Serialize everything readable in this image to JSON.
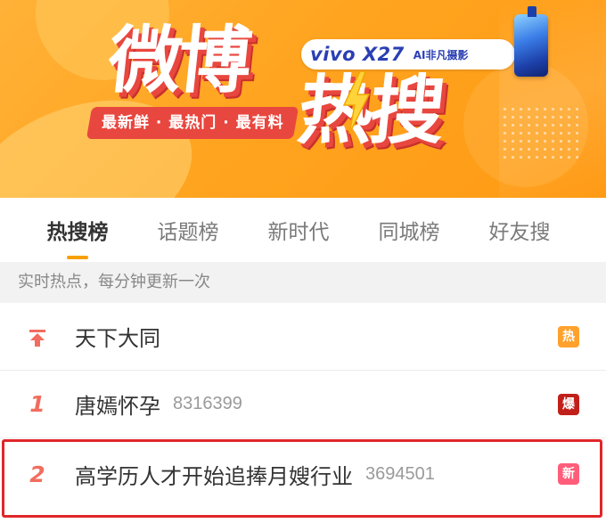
{
  "banner": {
    "logo_top": "微博",
    "logo_bottom": "热搜",
    "slogan": "最新鲜 · 最热门 · 最有料",
    "ad_brand": "vivo X27",
    "ad_tag": "AI非凡摄影",
    "colors": {
      "background": "#ffa41f",
      "accent_red": "#e8473f",
      "ad_blue": "#2b3fb3"
    }
  },
  "tabs": [
    {
      "label": "热搜榜",
      "active": true
    },
    {
      "label": "话题榜",
      "active": false
    },
    {
      "label": "新时代",
      "active": false
    },
    {
      "label": "同城榜",
      "active": false
    },
    {
      "label": "好友搜",
      "active": false
    }
  ],
  "subtitle": "实时热点，每分钟更新一次",
  "list": [
    {
      "rank": "",
      "rank_icon": "pinned-top-icon",
      "title": "天下大同",
      "count": "",
      "badge": "热",
      "badge_type": "hot"
    },
    {
      "rank": "1",
      "title": "唐嫣怀孕",
      "count": "8316399",
      "badge": "爆",
      "badge_type": "boom"
    },
    {
      "rank": "2",
      "title": "高学历人才开始追捧月嫂行业",
      "count": "3694501",
      "badge": "新",
      "badge_type": "new"
    }
  ],
  "colors": {
    "tab_indicator": "#f7a000",
    "rank": "#f26d5f",
    "highlight": "#e0262a"
  }
}
